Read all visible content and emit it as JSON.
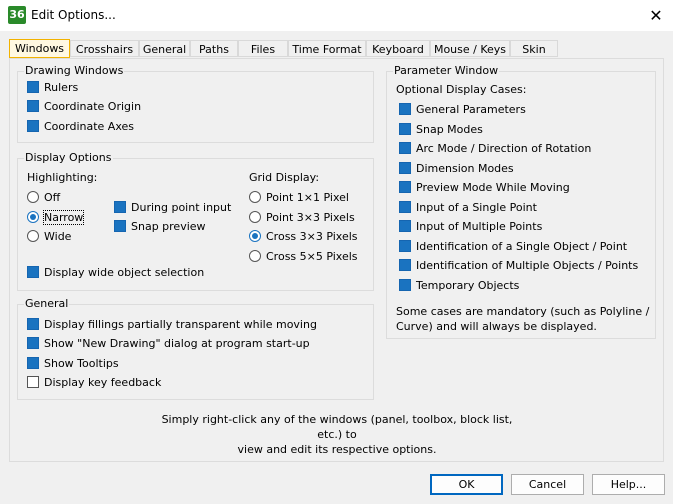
{
  "window": {
    "title": "Edit Options...",
    "app_icon_text": "36"
  },
  "tabs": [
    "Windows",
    "Crosshairs",
    "General",
    "Paths",
    "Files",
    "Time Format",
    "Keyboard",
    "Mouse / Keys",
    "Skin"
  ],
  "drawing_windows": {
    "title": "Drawing Windows",
    "items": [
      {
        "label": "Rulers",
        "checked": true
      },
      {
        "label": "Coordinate Origin",
        "checked": true
      },
      {
        "label": "Coordinate Axes",
        "checked": true
      }
    ]
  },
  "display_options": {
    "title": "Display Options",
    "highlighting_label": "Highlighting:",
    "highlighting": [
      {
        "label": "Off",
        "selected": false
      },
      {
        "label": "Narrow",
        "selected": true
      },
      {
        "label": "Wide",
        "selected": false
      }
    ],
    "extra": [
      {
        "label": "During point input",
        "checked": true
      },
      {
        "label": "Snap preview",
        "checked": true
      }
    ],
    "grid_label": "Grid Display:",
    "grid": [
      {
        "label": "Point 1×1 Pixel",
        "selected": false
      },
      {
        "label": "Point 3×3 Pixels",
        "selected": false
      },
      {
        "label": "Cross 3×3 Pixels",
        "selected": true
      },
      {
        "label": "Cross 5×5 Pixels",
        "selected": false
      }
    ],
    "wide_selection": {
      "label": "Display wide object selection",
      "checked": true
    }
  },
  "general": {
    "title": "General",
    "items": [
      {
        "label": "Display fillings partially transparent while moving",
        "checked": true
      },
      {
        "label": "Show \"New Drawing\" dialog at program start-up",
        "checked": true
      },
      {
        "label": "Show Tooltips",
        "checked": true
      },
      {
        "label": "Display key feedback",
        "checked": false
      }
    ]
  },
  "parameter_window": {
    "title": "Parameter Window",
    "subtitle": "Optional Display Cases:",
    "items": [
      {
        "label": "General Parameters",
        "checked": true
      },
      {
        "label": "Snap Modes",
        "checked": true
      },
      {
        "label": "Arc Mode / Direction of Rotation",
        "checked": true
      },
      {
        "label": "Dimension Modes",
        "checked": true
      },
      {
        "label": "Preview Mode While Moving",
        "checked": true
      },
      {
        "label": "Input of a Single Point",
        "checked": true
      },
      {
        "label": "Input of Multiple Points",
        "checked": true
      },
      {
        "label": "Identification of a Single Object / Point",
        "checked": true
      },
      {
        "label": "Identification of Multiple Objects / Points",
        "checked": true
      },
      {
        "label": "Temporary Objects",
        "checked": true
      }
    ],
    "note_line1": "Some cases are mandatory (such as Polyline /",
    "note_line2": "Curve) and will always be displayed."
  },
  "footer": {
    "line1": "Simply right-click any of the windows (panel, toolbox, block list, etc.) to",
    "line2": "view and edit its respective options."
  },
  "buttons": {
    "ok": "OK",
    "cancel": "Cancel",
    "help": "Help..."
  },
  "colors": {
    "accent": "#1a73c0",
    "active_tab": "#fff8e1",
    "active_tab_border": "#f2b200"
  }
}
